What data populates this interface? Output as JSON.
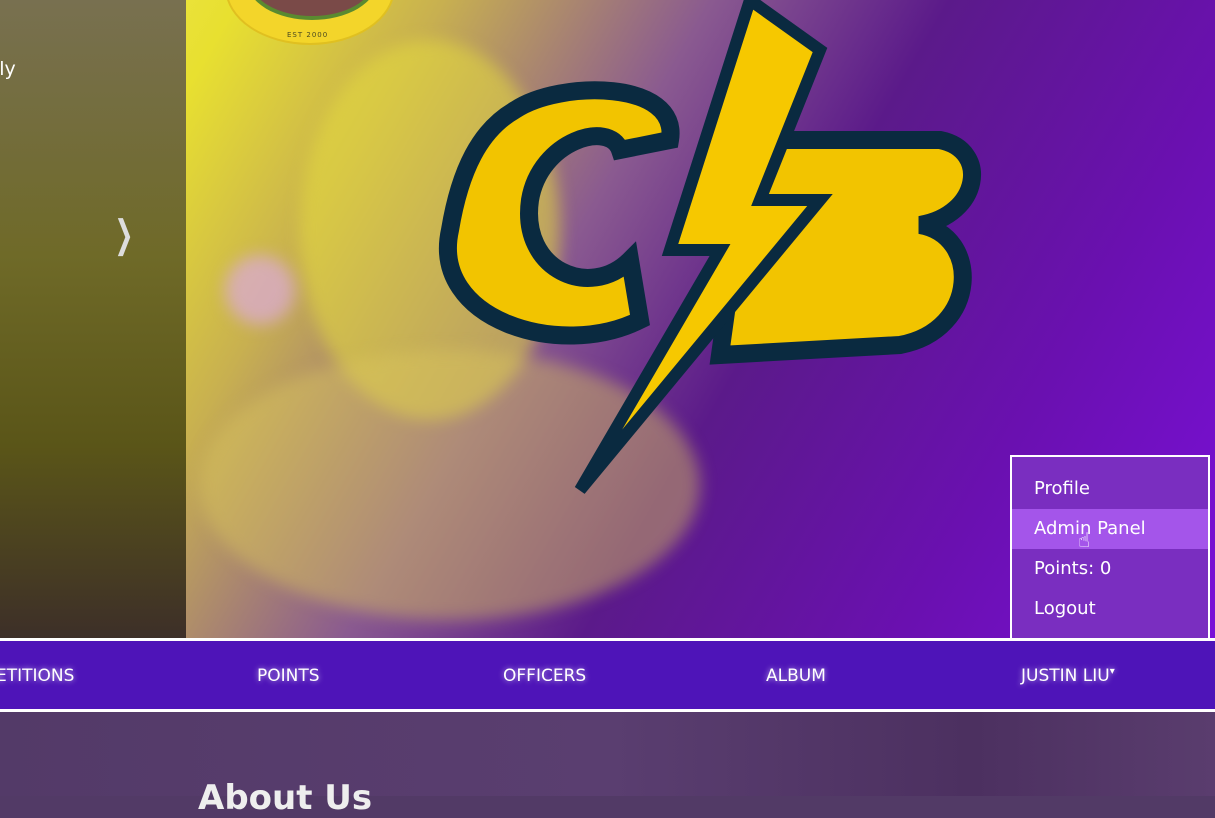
{
  "carousel": {
    "prev_slide_text": "lly",
    "next_icon": "chevron-right-icon",
    "badge_text": "EST 2000",
    "logo_text": "CB"
  },
  "user_menu": {
    "items": [
      {
        "label": "Profile"
      },
      {
        "label": "Admin Panel"
      },
      {
        "label": "Points: 0"
      },
      {
        "label": "Logout"
      }
    ]
  },
  "nav": {
    "items": [
      {
        "label": "ETITIONS"
      },
      {
        "label": "POINTS"
      },
      {
        "label": "OFFICERS"
      },
      {
        "label": "ALBUM"
      }
    ],
    "user_label": "JUSTIN LIU",
    "caret": "▾"
  },
  "content": {
    "heading": "About Us"
  },
  "colors": {
    "nav": "#4e14b8",
    "menu": "#7a2ec0",
    "menu_hover": "#a455ea"
  }
}
